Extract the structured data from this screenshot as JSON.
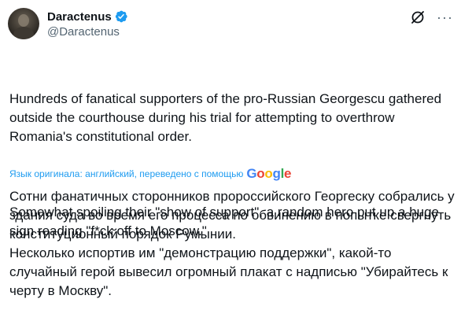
{
  "author": {
    "display_name": "Daractenus",
    "handle": "@Daractenus",
    "verified": true,
    "verified_color": "#1d9bf0"
  },
  "actions": {
    "grok_icon": "grok-icon",
    "more_label": "···"
  },
  "tweet": {
    "paragraphs": [
      "Hundreds of fanatical supporters of the pro-Russian Georgescu gathered outside the courthouse during his trial for attempting to overthrow Romania's constitutional order.",
      "Somewhat spoiling their \"show of support\", a random hero put up a huge sign reading \"f*ck off to Moscow.\""
    ]
  },
  "translation": {
    "label": "Язык оригинала: английский, переведено с помощью",
    "provider": "Google",
    "paragraphs": [
      "Сотни фанатичных сторонников пророссийского Георгеску собрались у здания суда во время его процесса по обвинению в попытке свергнуть конституционный порядок Румынии.",
      "Несколько испортив им \"демонстрацию поддержки\", какой-то случайный герой вывесил огромный плакат с надписью \"Убирайтесь к черту в Москву\"."
    ]
  }
}
